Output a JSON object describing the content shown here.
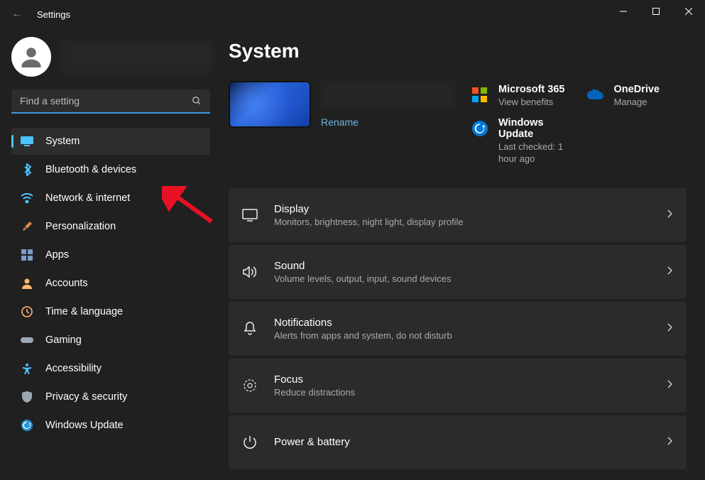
{
  "window": {
    "title": "Settings"
  },
  "search": {
    "placeholder": "Find a setting"
  },
  "nav": [
    {
      "label": "System",
      "icon": "display",
      "color": "#4cc2ff",
      "active": true
    },
    {
      "label": "Bluetooth & devices",
      "icon": "bluetooth",
      "color": "#4cc2ff"
    },
    {
      "label": "Network & internet",
      "icon": "wifi",
      "color": "#4cc2ff"
    },
    {
      "label": "Personalization",
      "icon": "brush",
      "color": "#e08050"
    },
    {
      "label": "Apps",
      "icon": "apps",
      "color": "#7a9cc6"
    },
    {
      "label": "Accounts",
      "icon": "person",
      "color": "#ffb870"
    },
    {
      "label": "Time & language",
      "icon": "clock",
      "color": "#ffb870"
    },
    {
      "label": "Gaming",
      "icon": "gamepad",
      "color": "#9ca9b4"
    },
    {
      "label": "Accessibility",
      "icon": "accessibility",
      "color": "#4cc2ff"
    },
    {
      "label": "Privacy & security",
      "icon": "shield",
      "color": "#9ca9b4"
    },
    {
      "label": "Windows Update",
      "icon": "update",
      "color": "#2593cf"
    }
  ],
  "page": {
    "title": "System",
    "rename": "Rename",
    "cards": {
      "ms365": {
        "title": "Microsoft 365",
        "sub": "View benefits"
      },
      "onedrive": {
        "title": "OneDrive",
        "sub": "Manage"
      },
      "update": {
        "title": "Windows Update",
        "sub": "Last checked: 1 hour ago"
      }
    },
    "items": [
      {
        "icon": "display",
        "title": "Display",
        "sub": "Monitors, brightness, night light, display profile"
      },
      {
        "icon": "sound",
        "title": "Sound",
        "sub": "Volume levels, output, input, sound devices"
      },
      {
        "icon": "bell",
        "title": "Notifications",
        "sub": "Alerts from apps and system, do not disturb"
      },
      {
        "icon": "focus",
        "title": "Focus",
        "sub": "Reduce distractions"
      },
      {
        "icon": "power",
        "title": "Power & battery",
        "sub": ""
      }
    ]
  }
}
